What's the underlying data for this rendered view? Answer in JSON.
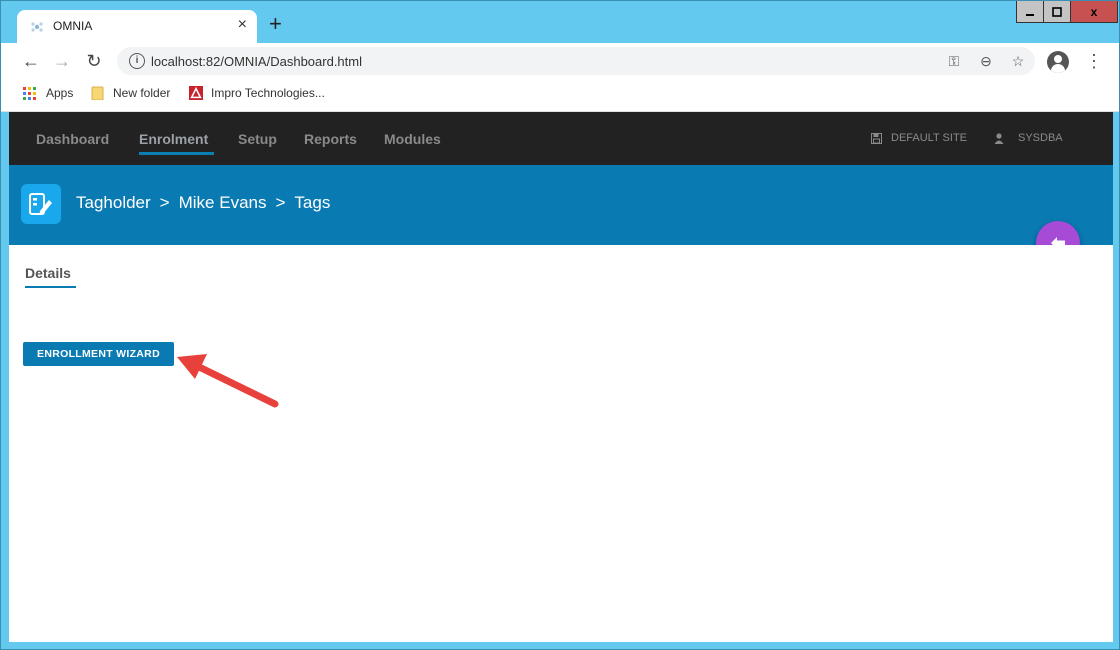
{
  "browser": {
    "tab_title": "OMNIA",
    "tab_close": "×",
    "new_tab": "+",
    "url": "localhost:82/OMNIA/Dashboard.html",
    "window_controls": {
      "minimize": "–",
      "maximize": "□",
      "close": "x"
    }
  },
  "bookmarks": [
    {
      "label": "Apps",
      "icon": "apps-grid-icon"
    },
    {
      "label": "New folder",
      "icon": "folder-icon"
    },
    {
      "label": "Impro Technologies...",
      "icon": "impro-logo-icon"
    }
  ],
  "app_nav": {
    "items": [
      "Dashboard",
      "Enrolment",
      "Setup",
      "Reports",
      "Modules"
    ],
    "active": "Enrolment",
    "site": "DEFAULT SITE",
    "user": "SYSDBA"
  },
  "header": {
    "breadcrumb": [
      "Tagholder",
      ">",
      "Mike Evans",
      ">",
      "Tags"
    ]
  },
  "content": {
    "tab_label": "Details",
    "wizard_button": "ENROLLMENT WIZARD"
  },
  "colors": {
    "accent": "#0a7ab3",
    "nav_bg": "#222222",
    "fab": "#a54bd6",
    "arrow": "#e8413c"
  }
}
